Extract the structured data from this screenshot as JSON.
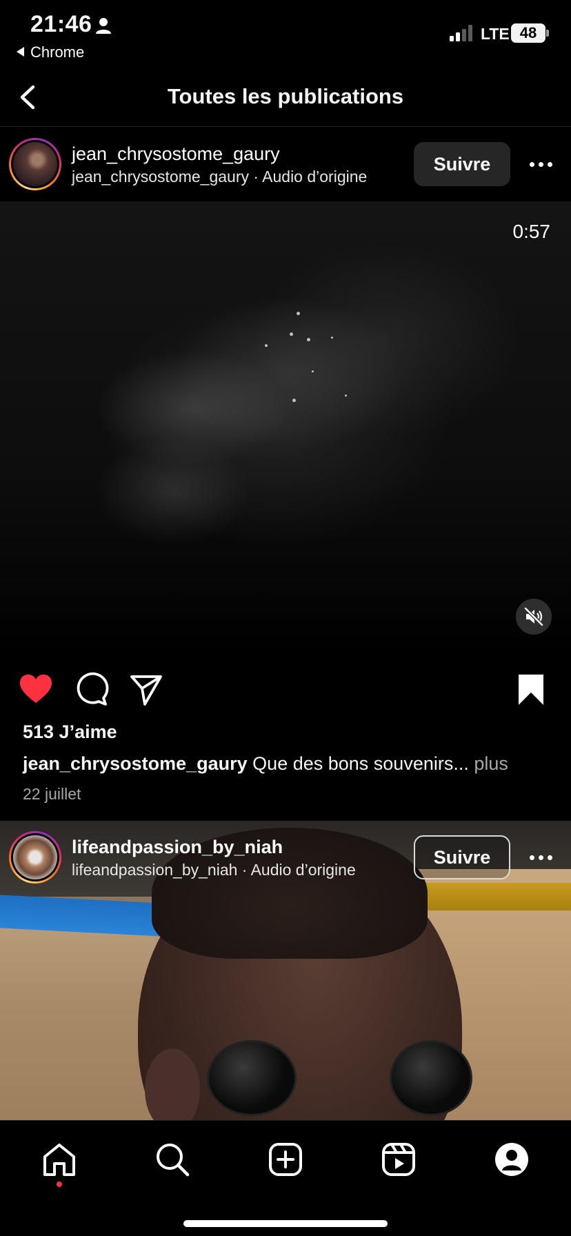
{
  "status_bar": {
    "time": "21:46",
    "back_app": "Chrome",
    "network": "LTE",
    "battery": "48"
  },
  "header": {
    "title": "Toutes les publications"
  },
  "posts": [
    {
      "username": "jean_chrysostome_gaury",
      "subline": "jean_chrysostome_gaury · Audio d’origine",
      "follow_label": "Suivre",
      "duration": "0:57",
      "likes": "513 J’aime",
      "caption_user": "jean_chrysostome_gaury",
      "caption_text": "Que des bons souvenirs...",
      "caption_more": "plus",
      "date": "22 juillet",
      "liked": true,
      "saved": true
    },
    {
      "username": "lifeandpassion_by_niah",
      "subline": "lifeandpassion_by_niah · Audio d’origine",
      "follow_label": "Suivre"
    }
  ],
  "tab_bar": {
    "items": [
      "home-icon",
      "search-icon",
      "create-icon",
      "reels-icon",
      "profile-icon"
    ],
    "active": "home-icon"
  },
  "colors": {
    "like": "#ff3040",
    "background": "#000000",
    "secondary_text": "#a8a8a8"
  }
}
